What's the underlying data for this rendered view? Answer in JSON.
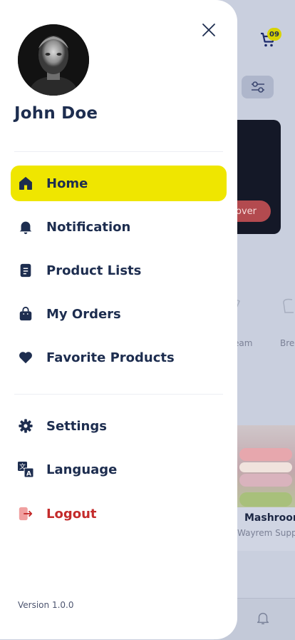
{
  "background": {
    "cart_badge": "09",
    "banner_button_label": "over",
    "category_labels": [
      "eam",
      "Bre"
    ],
    "product": {
      "name": "Mashroom",
      "shop": "Wayrem Supp"
    }
  },
  "drawer": {
    "user_name": "John Doe",
    "menu": [
      {
        "label": "Home",
        "icon": "home-icon",
        "active": true
      },
      {
        "label": "Notification",
        "icon": "bell-icon",
        "active": false
      },
      {
        "label": "Product Lists",
        "icon": "list-document-icon",
        "active": false
      },
      {
        "label": "My Orders",
        "icon": "shopping-bag-icon",
        "active": false
      },
      {
        "label": "Favorite Products",
        "icon": "heart-icon",
        "active": false
      }
    ],
    "secondary_menu": [
      {
        "label": "Settings",
        "icon": "gear-icon"
      },
      {
        "label": "Language",
        "icon": "translate-icon"
      },
      {
        "label": "Logout",
        "icon": "logout-icon"
      }
    ],
    "version": "Version 1.0.0"
  },
  "colors": {
    "accent_yellow": "#efe600",
    "text_navy": "#1d2d4f",
    "logout_red": "#c42b2b",
    "overlay": "#c9cfde"
  }
}
